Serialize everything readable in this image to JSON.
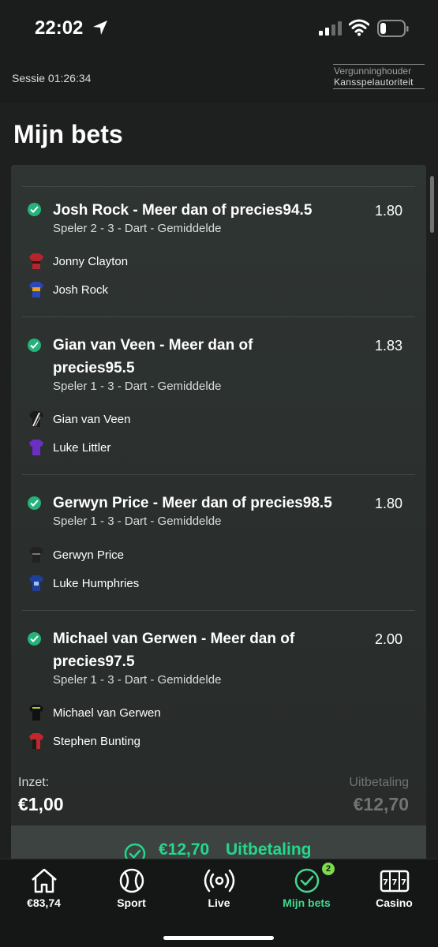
{
  "status_bar": {
    "time": "22:02"
  },
  "session": {
    "label": "Sessie 01:26:34",
    "license_line1": "Vergunninghouder",
    "license_line2": "Kansspelautoriteit"
  },
  "page": {
    "title": "Mijn bets"
  },
  "bets": [
    {
      "title_line1": "Josh Rock - Meer dan of precies94.5",
      "title_line2": "",
      "odds": "1.80",
      "subtitle": "Speler 2 - 3 - Dart - Gemiddelde",
      "players": [
        {
          "name": "Jonny Clayton",
          "shirt_color": "#b3262b"
        },
        {
          "name": "Josh Rock",
          "shirt_color": "#2a46b8"
        }
      ]
    },
    {
      "title_line1": "Gian van Veen - Meer dan of",
      "title_line2": "precies95.5",
      "odds": "1.83",
      "subtitle": "Speler 1 - 3 - Dart - Gemiddelde",
      "players": [
        {
          "name": "Gian van Veen",
          "shirt_color": "#1a1a1a"
        },
        {
          "name": "Luke Littler",
          "shirt_color": "#6a2fc4"
        }
      ]
    },
    {
      "title_line1": "Gerwyn Price - Meer dan of precies98.5",
      "title_line2": "",
      "odds": "1.80",
      "subtitle": "Speler 1 - 3 - Dart - Gemiddelde",
      "players": [
        {
          "name": "Gerwyn Price",
          "shirt_color": "#222222"
        },
        {
          "name": "Luke Humphries",
          "shirt_color": "#1f3f9a"
        }
      ]
    },
    {
      "title_line1": "Michael van Gerwen - Meer dan of",
      "title_line2": "precies97.5",
      "odds": "2.00",
      "subtitle": "Speler 1 - 3 - Dart - Gemiddelde",
      "players": [
        {
          "name": "Michael van Gerwen",
          "shirt_color": "#111111"
        },
        {
          "name": "Stephen Bunting",
          "shirt_color": "#c0282d"
        }
      ]
    }
  ],
  "summary": {
    "stake_label": "Inzet:",
    "stake_value": "€1,00",
    "payout_label": "Uitbetaling",
    "payout_value": "€12,70"
  },
  "cashout": {
    "amount": "€12,70",
    "label": "Uitbetaling"
  },
  "nav": {
    "items": [
      {
        "label": "€83,74",
        "icon": "home-icon"
      },
      {
        "label": "Sport",
        "icon": "tennis-ball-icon"
      },
      {
        "label": "Live",
        "icon": "live-broadcast-icon"
      },
      {
        "label": "Mijn bets",
        "icon": "check-circle-icon",
        "badge": "2"
      },
      {
        "label": "Casino",
        "icon": "slot-machine-icon"
      }
    ]
  },
  "colors": {
    "accent": "#42d88f",
    "check": "#24b37a",
    "badge": "#7fdc4a"
  }
}
